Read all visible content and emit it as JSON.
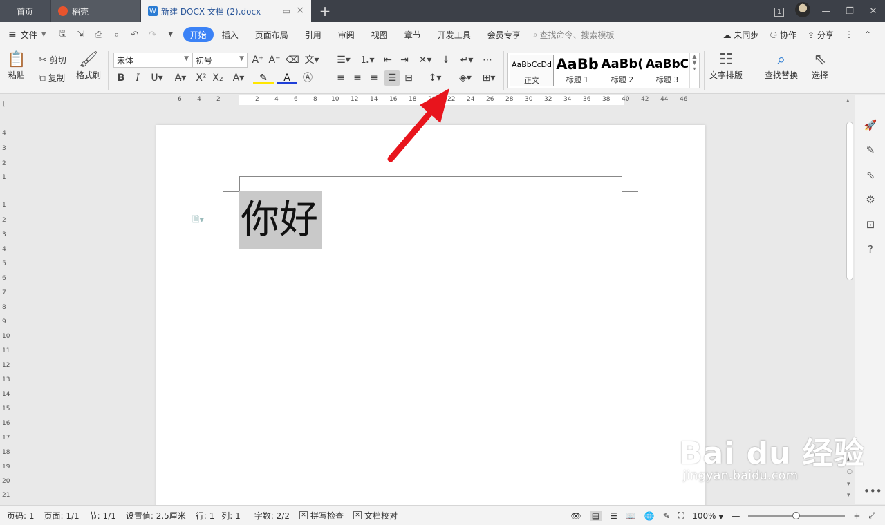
{
  "titlebar": {
    "tab_home": "首页",
    "tab_daoke": "稻壳",
    "tab_doc": "新建 DOCX 文档 (2).docx",
    "doc_icon_letter": "W",
    "window_count": "1"
  },
  "menubar": {
    "file": "文件",
    "tabs": [
      "开始",
      "插入",
      "页面布局",
      "引用",
      "审阅",
      "视图",
      "章节",
      "开发工具",
      "会员专享"
    ],
    "search_placeholder": "查找命令、搜索模板",
    "sync": "未同步",
    "collab": "协作",
    "share": "分享"
  },
  "ribbon": {
    "paste": "粘贴",
    "cut": "剪切",
    "copy": "复制",
    "format_painter": "格式刷",
    "font_name": "宋体",
    "font_size": "初号",
    "styles": [
      {
        "sample": "AaBbCcDd",
        "label": "正文"
      },
      {
        "sample": "AaBb",
        "label": "标题 1"
      },
      {
        "sample": "AaBb(",
        "label": "标题 2"
      },
      {
        "sample": "AaBbC",
        "label": "标题 3"
      }
    ],
    "text_layout": "文字排版",
    "find_replace": "查找替换",
    "select": "选择"
  },
  "ruler": {
    "h_left_ticks": [
      "6",
      "4",
      "2"
    ],
    "h_ticks": [
      "2",
      "4",
      "6",
      "8",
      "10",
      "12",
      "14",
      "16",
      "18",
      "20",
      "22",
      "24",
      "26",
      "28",
      "30",
      "32",
      "34",
      "36",
      "38",
      "40",
      "42",
      "44",
      "46"
    ],
    "v_ticks": [
      "4",
      "3",
      "2",
      "1",
      "1",
      "2",
      "3",
      "4",
      "5",
      "6",
      "7",
      "8",
      "9",
      "10",
      "11",
      "12",
      "13",
      "14",
      "15",
      "16",
      "17",
      "18",
      "19",
      "20",
      "21"
    ]
  },
  "document": {
    "text": "你好"
  },
  "statusbar": {
    "page_no": "页码: 1",
    "pages": "页面: 1/1",
    "section": "节: 1/1",
    "setting": "设置值: 2.5厘米",
    "row": "行: 1",
    "col": "列: 1",
    "word_count": "字数: 2/2",
    "spellcheck": "拼写检查",
    "doc_check": "文档校对",
    "zoom": "100%"
  },
  "watermark": {
    "main": "Bai du 经验",
    "sub": "jingyan.baidu.com"
  },
  "colors": {
    "accent": "#3b82f6",
    "titlebar": "#3c4048",
    "arrow": "#e8141c",
    "selection": "#c9c9c9"
  }
}
